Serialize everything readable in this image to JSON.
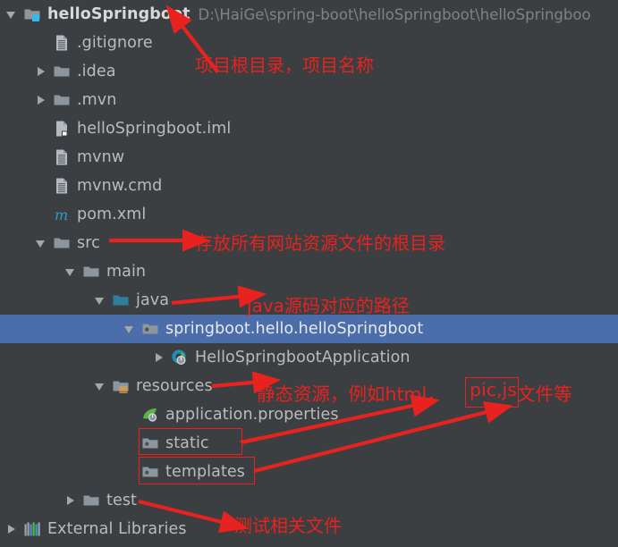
{
  "window": {
    "kind": "ide-project-tree",
    "background_color": "#3c3f41",
    "selection_color": "#4b6eab",
    "text_color": "#bbbbbb",
    "annotation_color": "#e8221f"
  },
  "tree": {
    "rows": [
      {
        "id": "root",
        "label": "helloSpringboot",
        "path": "D:\\HaiGe\\spring-boot\\helloSpringboot\\helloSpringboo",
        "depth": 0,
        "twisty": "open",
        "icon": "module-folder-icon",
        "bold": true,
        "selected": false
      },
      {
        "id": "gitignore",
        "label": ".gitignore",
        "path": "",
        "depth": 1,
        "twisty": "none",
        "icon": "text-file-icon",
        "bold": false,
        "selected": false
      },
      {
        "id": "idea",
        "label": ".idea",
        "path": "",
        "depth": 1,
        "twisty": "closed",
        "icon": "folder-icon",
        "bold": false,
        "selected": false
      },
      {
        "id": "mvn",
        "label": ".mvn",
        "path": "",
        "depth": 1,
        "twisty": "closed",
        "icon": "folder-icon",
        "bold": false,
        "selected": false
      },
      {
        "id": "iml",
        "label": "helloSpringboot.iml",
        "path": "",
        "depth": 1,
        "twisty": "none",
        "icon": "iml-file-icon",
        "bold": false,
        "selected": false
      },
      {
        "id": "mvnw",
        "label": "mvnw",
        "path": "",
        "depth": 1,
        "twisty": "none",
        "icon": "text-file-icon",
        "bold": false,
        "selected": false
      },
      {
        "id": "mvnwcmd",
        "label": "mvnw.cmd",
        "path": "",
        "depth": 1,
        "twisty": "none",
        "icon": "text-file-icon",
        "bold": false,
        "selected": false
      },
      {
        "id": "pom",
        "label": "pom.xml",
        "path": "",
        "depth": 1,
        "twisty": "none",
        "icon": "maven-m-icon",
        "bold": false,
        "selected": false
      },
      {
        "id": "src",
        "label": "src",
        "path": "",
        "depth": 1,
        "twisty": "open",
        "icon": "folder-icon",
        "bold": false,
        "selected": false
      },
      {
        "id": "main",
        "label": "main",
        "path": "",
        "depth": 2,
        "twisty": "open",
        "icon": "folder-icon",
        "bold": false,
        "selected": false
      },
      {
        "id": "java",
        "label": "java",
        "path": "",
        "depth": 3,
        "twisty": "open",
        "icon": "source-root-folder-icon",
        "bold": false,
        "selected": false
      },
      {
        "id": "pkg",
        "label": "springboot.hello.helloSpringboot",
        "path": "",
        "depth": 4,
        "twisty": "open",
        "icon": "package-icon",
        "bold": false,
        "selected": true
      },
      {
        "id": "app",
        "label": "HelloSpringbootApplication",
        "path": "",
        "depth": 5,
        "twisty": "closed",
        "icon": "spring-class-run-icon",
        "bold": false,
        "selected": false
      },
      {
        "id": "resources",
        "label": "resources",
        "path": "",
        "depth": 3,
        "twisty": "open",
        "icon": "resources-root-folder-icon",
        "bold": false,
        "selected": false
      },
      {
        "id": "appprops",
        "label": "application.properties",
        "path": "",
        "depth": 4,
        "twisty": "none",
        "icon": "spring-leaf-icon",
        "bold": false,
        "selected": false
      },
      {
        "id": "static",
        "label": "static",
        "path": "",
        "depth": 4,
        "twisty": "none",
        "icon": "package-icon",
        "bold": false,
        "selected": false
      },
      {
        "id": "templates",
        "label": "templates",
        "path": "",
        "depth": 4,
        "twisty": "none",
        "icon": "package-icon",
        "bold": false,
        "selected": false
      },
      {
        "id": "test",
        "label": "test",
        "path": "",
        "depth": 2,
        "twisty": "closed",
        "icon": "folder-icon",
        "bold": false,
        "selected": false
      },
      {
        "id": "extlibs",
        "label": "External Libraries",
        "path": "",
        "depth": 0,
        "twisty": "closed",
        "icon": "external-libraries-icon",
        "bold": false,
        "selected": false
      }
    ]
  },
  "annotations": {
    "root_note": "项目根目录，项目名称",
    "src_note": "存放所有网站资源文件的根目录",
    "java_note": "java源码对应的路径",
    "resources_note_a": "静态资源，例如html，",
    "resources_note_b": "pic,js",
    "resources_note_c": "文件等",
    "test_note": "测试相关文件"
  }
}
